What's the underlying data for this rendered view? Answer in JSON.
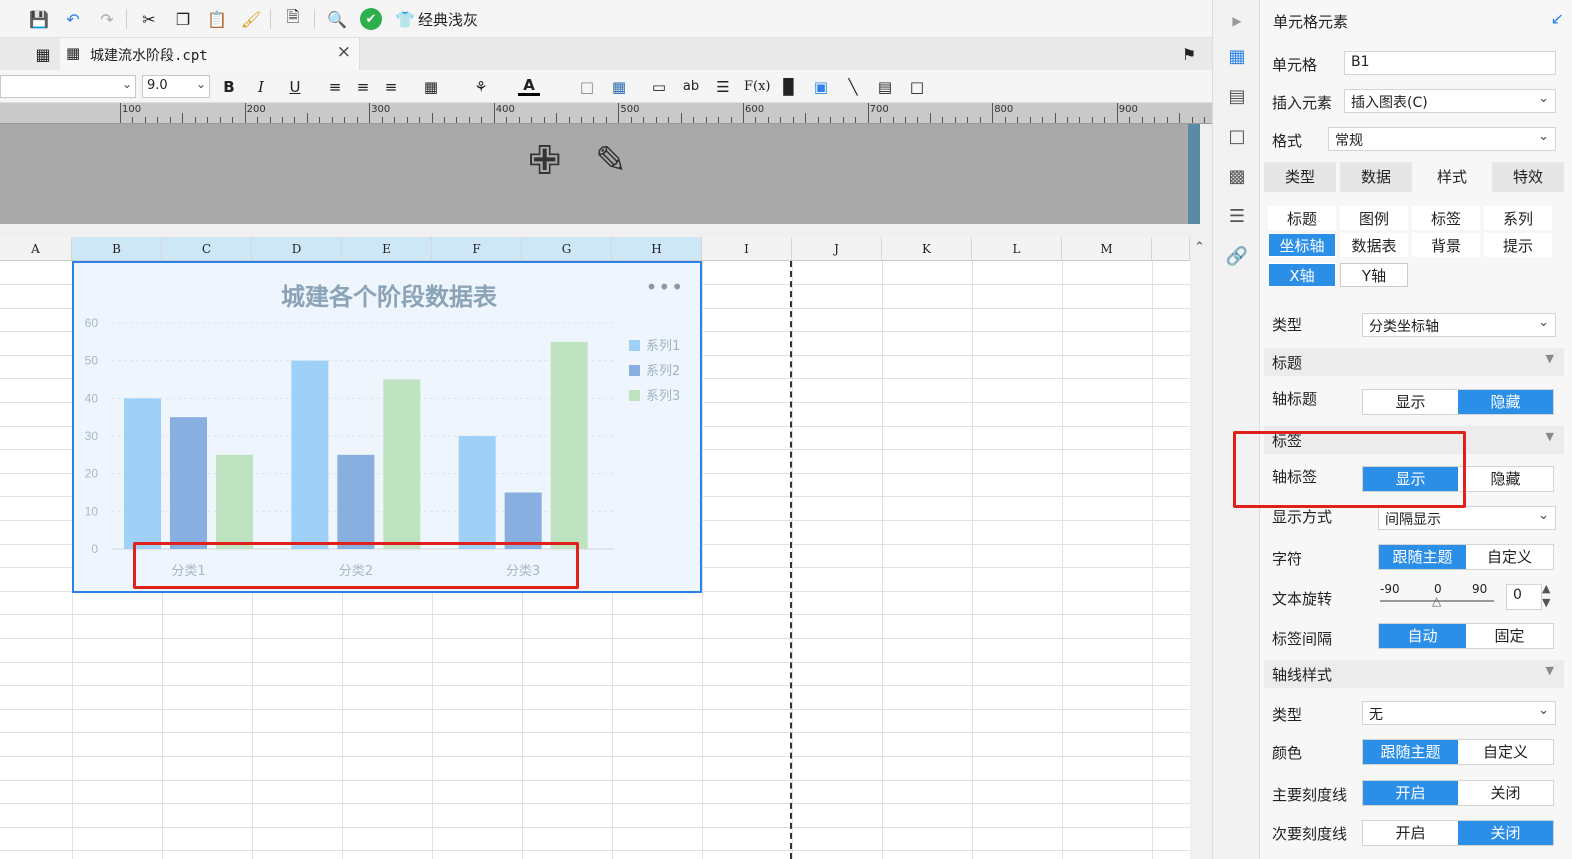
{
  "toolbar": {
    "theme_label": "经典浅灰"
  },
  "tab": {
    "file_name": "城建流水阶段.cpt",
    "close": "×"
  },
  "format": {
    "font_size": "9.0"
  },
  "ruler": {
    "labels": [
      "100",
      "200",
      "300",
      "400",
      "500",
      "600",
      "700",
      "800",
      "900"
    ]
  },
  "sheet": {
    "columns": [
      "A",
      "B",
      "C",
      "D",
      "E",
      "F",
      "G",
      "H",
      "I",
      "J",
      "K",
      "L",
      "M"
    ],
    "selected_columns": [
      "B",
      "C",
      "D",
      "E",
      "F",
      "G",
      "H"
    ]
  },
  "chart_data": {
    "type": "bar",
    "title": "城建各个阶段数据表",
    "categories": [
      "分类1",
      "分类2",
      "分类3"
    ],
    "series": [
      {
        "name": "系列1",
        "color": "#9fd0f8",
        "values": [
          40,
          50,
          30
        ]
      },
      {
        "name": "系列2",
        "color": "#89aee0",
        "values": [
          35,
          25,
          15
        ]
      },
      {
        "name": "系列3",
        "color": "#bfe3c0",
        "values": [
          25,
          45,
          55
        ]
      }
    ],
    "ylim": [
      0,
      60
    ],
    "yticks": [
      "0",
      "10",
      "20",
      "30",
      "40",
      "50",
      "60"
    ],
    "grid": true,
    "legend": "right"
  },
  "panel": {
    "title": "单元格元素",
    "cell_label": "单元格",
    "cell_value": "B1",
    "insert_label": "插入元素",
    "insert_value": "插入图表(C)",
    "format_label": "格式",
    "format_value": "常规",
    "main_tabs": [
      "类型",
      "数据",
      "样式",
      "特效"
    ],
    "sub_tabs": [
      "标题",
      "图例",
      "标签",
      "系列",
      "坐标轴",
      "数据表",
      "背景",
      "提示"
    ],
    "axis_tabs": [
      "X轴",
      "Y轴"
    ],
    "type_label": "类型",
    "type_value": "分类坐标轴",
    "sec_title": "标题",
    "axis_title_label": "轴标题",
    "show": "显示",
    "hide": "隐藏",
    "sec_label": "标签",
    "axis_label_label": "轴标签",
    "display_mode_label": "显示方式",
    "display_mode_value": "间隔显示",
    "char_label": "字符",
    "follow_theme": "跟随主题",
    "custom": "自定义",
    "rotation_label": "文本旋转",
    "rotation_min": "-90",
    "rotation_mid": "0",
    "rotation_max": "90",
    "rotation_value": "0",
    "interval_label": "标签间隔",
    "auto": "自动",
    "fixed": "固定",
    "sec_axis_style": "轴线样式",
    "line_type_label": "类型",
    "line_type_value": "无",
    "color_label": "颜色",
    "major_tick_label": "主要刻度线",
    "minor_tick_label": "次要刻度线",
    "on": "开启",
    "off": "关闭"
  }
}
